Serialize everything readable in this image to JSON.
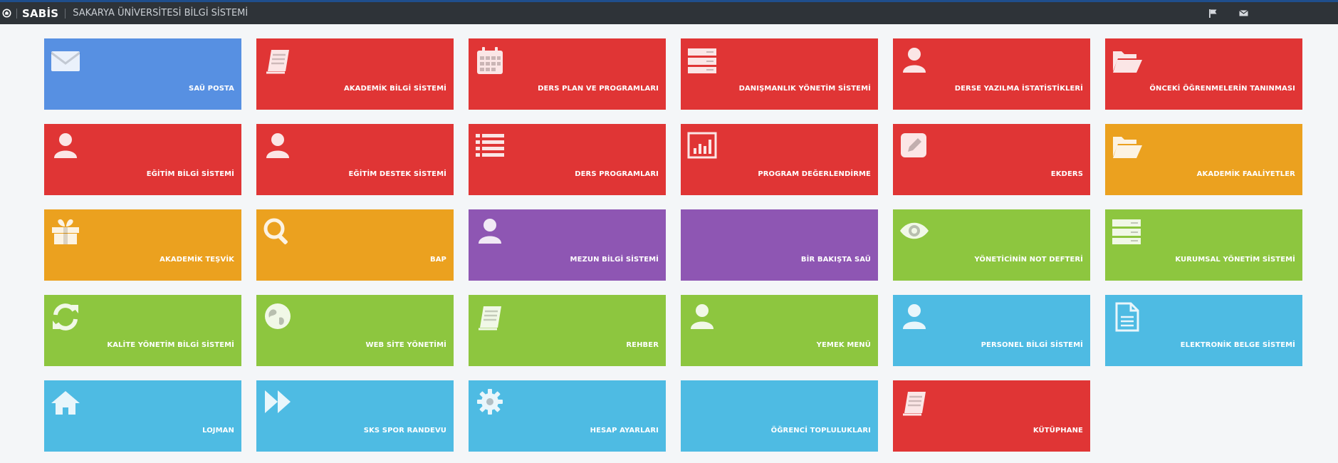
{
  "app": {
    "brand": "SABİS",
    "title": "SAKARYA ÜNİVERSİTESİ BİLGİ SİSTEMİ"
  },
  "header": {
    "icons": [
      {
        "name": "flag-icon"
      },
      {
        "name": "mail-icon"
      }
    ]
  },
  "colors": {
    "blue": "#5790e2",
    "red": "#e03535",
    "orange": "#eba11f",
    "purple": "#8e56b3",
    "green": "#8dc63f",
    "cyan": "#4ebbe3",
    "icon_light": "#ffffff"
  },
  "tiles": [
    {
      "label": "SAÜ POSTA",
      "icon": "envelope-icon",
      "color": "blue"
    },
    {
      "label": "AKADEMİK BİLGİ SİSTEMİ",
      "icon": "book-icon",
      "color": "red"
    },
    {
      "label": "DERS PLAN VE PROGRAMLARI",
      "icon": "calendar-icon",
      "color": "red"
    },
    {
      "label": "DANIŞMANLIK YÖNETİM SİSTEMİ",
      "icon": "server-icon",
      "color": "red"
    },
    {
      "label": "DERSE YAZILMA İSTATİSTİKLERİ",
      "icon": "user-icon",
      "color": "red"
    },
    {
      "label": "ÖNCEKİ ÖĞRENMELERİN TANINMASI",
      "icon": "folder-open-icon",
      "color": "red"
    },
    {
      "label": "EĞİTİM BİLGİ SİSTEMİ",
      "icon": "user-icon",
      "color": "red"
    },
    {
      "label": "EĞİTİM DESTEK SİSTEMİ",
      "icon": "user-icon",
      "color": "red"
    },
    {
      "label": "DERS PROGRAMLARI",
      "icon": "list-icon",
      "color": "red"
    },
    {
      "label": "PROGRAM DEĞERLENDİRME",
      "icon": "bar-chart-icon",
      "color": "red"
    },
    {
      "label": "EKDERS",
      "icon": "edit-icon",
      "color": "red"
    },
    {
      "label": "AKADEMİK FAALİYETLER",
      "icon": "folder-open-icon",
      "color": "orange"
    },
    {
      "label": "AKADEMİK TEŞVİK",
      "icon": "gift-icon",
      "color": "orange"
    },
    {
      "label": "BAP",
      "icon": "search-icon",
      "color": "orange"
    },
    {
      "label": "MEZUN BİLGİ SİSTEMİ",
      "icon": "user-icon",
      "color": "purple"
    },
    {
      "label": "BİR BAKIŞTA SAÜ",
      "icon": "",
      "color": "purple"
    },
    {
      "label": "YÖNETİCİNİN NOT DEFTERİ",
      "icon": "eye-icon",
      "color": "green"
    },
    {
      "label": "KURUMSAL YÖNETİM SİSTEMİ",
      "icon": "server-icon",
      "color": "green"
    },
    {
      "label": "KALİTE YÖNETİM BİLGİ SİSTEMİ",
      "icon": "refresh-icon",
      "color": "green"
    },
    {
      "label": "WEB SİTE YÖNETİMİ",
      "icon": "globe-icon",
      "color": "green"
    },
    {
      "label": "REHBER",
      "icon": "book-icon",
      "color": "green"
    },
    {
      "label": "YEMEK MENÜ",
      "icon": "user-icon",
      "color": "green"
    },
    {
      "label": "PERSONEL BİLGİ SİSTEMİ",
      "icon": "user-icon",
      "color": "cyan"
    },
    {
      "label": "ELEKTRONİK BELGE SİSTEMİ",
      "icon": "file-icon",
      "color": "cyan"
    },
    {
      "label": "LOJMAN",
      "icon": "home-icon",
      "color": "cyan"
    },
    {
      "label": "SKS SPOR RANDEVU",
      "icon": "fast-forward-icon",
      "color": "cyan"
    },
    {
      "label": "HESAP AYARLARI",
      "icon": "cog-icon",
      "color": "cyan"
    },
    {
      "label": "ÖĞRENCİ TOPLULUKLARI",
      "icon": "",
      "color": "cyan"
    },
    {
      "label": "KÜTÜPHANE",
      "icon": "book-icon",
      "color": "red"
    }
  ]
}
